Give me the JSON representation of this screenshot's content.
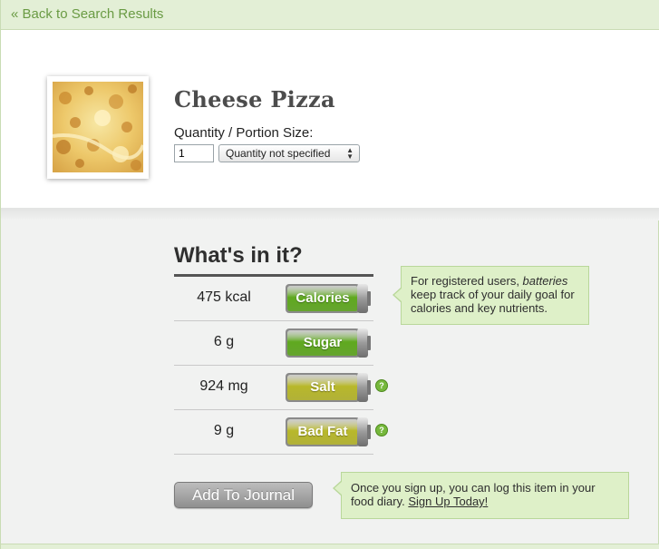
{
  "nav": {
    "back_label": "« Back to Search Results"
  },
  "food": {
    "name": "Cheese Pizza",
    "image_icon": "pizza-photo"
  },
  "quantity": {
    "label": "Quantity / Portion Size:",
    "value": "1",
    "unit_selected": "Quantity not specified"
  },
  "nutrition": {
    "title": "What's in it?",
    "rows": [
      {
        "value": "475 kcal",
        "battery_label": "Calories",
        "level": "green",
        "color": "#5fa91f",
        "help": false
      },
      {
        "value": "6 g",
        "battery_label": "Sugar",
        "level": "green",
        "color": "#5fa91f",
        "help": false
      },
      {
        "value": "924 mg",
        "battery_label": "Salt",
        "level": "yellow",
        "color": "#b8b82a",
        "help": true
      },
      {
        "value": "9 g",
        "battery_label": "Bad Fat",
        "level": "yellow",
        "color": "#b8b82a",
        "help": true
      }
    ],
    "help_glyph": "?"
  },
  "info_callout": {
    "text_before": "For registered users, ",
    "text_emphasis": "batteries",
    "text_after": " keep track of your daily goal for calories and key nutrients."
  },
  "journal": {
    "button_label": "Add To Journal",
    "callout_text": "Once you sign up, you can log this item in your food diary. ",
    "signup_link": "Sign Up Today!"
  },
  "colors": {
    "accent_green": "#6a9b44",
    "top_bar": "#e3efd6",
    "callout_bg": "#def0c8",
    "battery_green": "#5fa91f",
    "battery_yellow": "#b8b82a"
  }
}
